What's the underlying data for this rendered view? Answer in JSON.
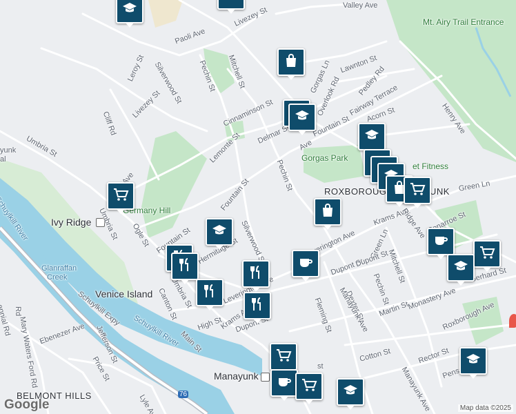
{
  "colors": {
    "background": "#eceef1",
    "park": "#c5e6c8",
    "water": "#9ad1e6",
    "road": "#ffffff",
    "marker": "#0f4c6b"
  },
  "map": {
    "neighborhoods": {
      "roxborough_manayunk": "ROXBOROUGH-MANAYUNK",
      "belmont_hills": "BELMONT HILLS",
      "venice_island": "Venice Island",
      "manayunk": "Manayunk",
      "ivy_ridge": "Ivy Ridge",
      "germany_hill": "Germany Hill",
      "gorgas_park": "Gorgas Park",
      "mt_airy_trail": "Mt. Airy Trail Entrance",
      "glanraffan_creek_1": "Glanraffan",
      "glanraffan_creek_2": "Creek",
      "manayunk_partial_1": "yunk",
      "manayunk_partial_2": "al",
      "fitness": "et Fitness"
    },
    "water": {
      "schuylkill_1": "Schuylkill River",
      "schuylkill_2": "Schuylkill River",
      "schuylkill_expy": "Schuylkill Expy",
      "route_76": "76"
    },
    "streets": {
      "valley_ave": "Valley Ave",
      "livezey_st_top": "Livezey St",
      "paoli_ave": "Paoli Ave",
      "lawnton_st": "Lawnton St",
      "pedley_rd": "Pedley Rd",
      "fairway_terrace": "Fairway Terrace",
      "overlook_rd": "Overlook Rd",
      "fountain_st_1": "Fountain St",
      "acorn_st": "Acorn St",
      "henry_ave": "Henry Ave",
      "leroy_st": "Leroy St",
      "silverwood_st_1": "Silverwood St",
      "pechin_st_1": "Pechin St",
      "mitchell_st_1": "Mitchell St",
      "cinnaminson_st": "Cinnaminson St",
      "livezey_st": "Livezey St",
      "cliff_rd": "Cliff Rd",
      "delmar_st": "Delmar St",
      "lemonte_st": "Lemonte St",
      "umbria_st_1": "Umbria St",
      "pechin_st_2": "Pechin St",
      "fountain_st_2": "Fountain St",
      "ogle_st": "Ogle St",
      "umbria_st_2": "Umbria St",
      "fountain_st_3": "Fountain St",
      "hermitage_st": "Hermitage St",
      "silverwood_st_2": "Silverwood St",
      "leverington_ave_1": "Leverington Ave",
      "krams_ave_1": "Krams Ave",
      "ridge_ave": "Ridge Ave",
      "conarroe_st": "Conarroe St",
      "green_ln_1": "Green Ln",
      "green_ln_2": "Green Ln",
      "mitchell_st_2": "Mitchell St",
      "dupont_st_1": "Dupont St",
      "dexter_st": "Dexter St",
      "pechin_st_3": "Pechin St",
      "martin_st": "Martin St",
      "monastery_ave": "Monastery Ave",
      "gerhard_st": "Gerhard St",
      "roxborough_ave": "Roxborough Ave",
      "fleming_st": "Fleming St",
      "manayunk_ave_1": "Manayunk Ave",
      "manayunk_ave_2": "Manayunk Ave",
      "cotton_st": "Cotton St",
      "rector_st": "Rector St",
      "pensdale_st": "Pensdale St",
      "leverington_ave_2": "Leverington Ave",
      "krams_ave_2": "Krams Ave",
      "dupont_st_2": "Dupont St",
      "canton_st": "Canton St",
      "umbria_st_3": "Umbria St",
      "high_st": "High St",
      "main_st": "Main St",
      "jefferson_st": "Jefferson St",
      "price_st": "Price St",
      "ebenezer_ave": "Ebenezer Ave",
      "mary_waters_ford_rd": "Mary Waters Ford Rd",
      "lyle_ave": "Lyle Ave",
      "ennial_rd": "ennial Rd",
      "rd_left": "Rd",
      "gorgas_ln": "Gorgas Ln",
      "ave_left": "Ave",
      "ave_gorgas": "Ave",
      "cotton_st_partial": "st"
    },
    "markers": [
      {
        "icon": "school-icon"
      },
      {
        "icon": "school-icon"
      },
      {
        "icon": "shopping-bag-icon"
      },
      {
        "icon": "school-icon"
      },
      {
        "icon": "school-icon"
      },
      {
        "icon": "fitness-icon"
      },
      {
        "icon": "school-icon"
      },
      {
        "icon": "shopping-bag-icon"
      },
      {
        "icon": "shopping-cart-icon"
      },
      {
        "icon": "shopping-cart-icon"
      },
      {
        "icon": "school-icon"
      },
      {
        "icon": "shopping-bag-icon"
      },
      {
        "icon": "coffee-icon"
      },
      {
        "icon": "coffee-icon"
      },
      {
        "icon": "shopping-cart-icon"
      },
      {
        "icon": "restaurant-icon"
      },
      {
        "icon": "restaurant-icon"
      },
      {
        "icon": "restaurant-icon"
      },
      {
        "icon": "restaurant-icon"
      },
      {
        "icon": "school-icon"
      },
      {
        "icon": "restaurant-icon"
      },
      {
        "icon": "shopping-cart-icon"
      },
      {
        "icon": "coffee-icon"
      },
      {
        "icon": "shopping-cart-icon"
      },
      {
        "icon": "school-icon"
      },
      {
        "icon": "school-icon"
      }
    ],
    "attribution": "Map data ©2025",
    "logo": "Google"
  }
}
